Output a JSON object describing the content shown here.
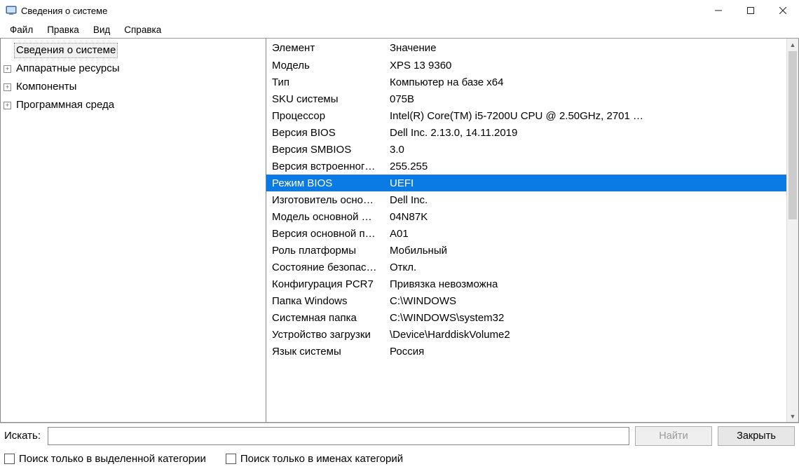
{
  "window": {
    "title": "Сведения о системе"
  },
  "menu": {
    "items": [
      "Файл",
      "Правка",
      "Вид",
      "Справка"
    ]
  },
  "tree": {
    "items": [
      {
        "label": "Сведения о системе",
        "selected": true,
        "expandable": false
      },
      {
        "label": "Аппаратные ресурсы",
        "selected": false,
        "expandable": true
      },
      {
        "label": "Компоненты",
        "selected": false,
        "expandable": true
      },
      {
        "label": "Программная среда",
        "selected": false,
        "expandable": true
      }
    ]
  },
  "list": {
    "columns": [
      "Элемент",
      "Значение"
    ],
    "selected_index": 7,
    "rows": [
      {
        "name": "Модель",
        "value": "XPS 13 9360"
      },
      {
        "name": "Тип",
        "value": "Компьютер на базе x64"
      },
      {
        "name": "SKU системы",
        "value": "075B"
      },
      {
        "name": "Процессор",
        "value": "Intel(R) Core(TM) i5-7200U CPU @ 2.50GHz, 2701 …"
      },
      {
        "name": "Версия BIOS",
        "value": "Dell Inc. 2.13.0, 14.11.2019"
      },
      {
        "name": "Версия SMBIOS",
        "value": "3.0"
      },
      {
        "name": "Версия встроенног…",
        "value": "255.255"
      },
      {
        "name": "Режим BIOS",
        "value": "UEFI"
      },
      {
        "name": "Изготовитель осно…",
        "value": "Dell Inc."
      },
      {
        "name": "Модель основной …",
        "value": "04N87K"
      },
      {
        "name": "Версия основной п…",
        "value": "A01"
      },
      {
        "name": "Роль платформы",
        "value": "Мобильный"
      },
      {
        "name": "Состояние безопас…",
        "value": "Откл."
      },
      {
        "name": "Конфигурация PCR7",
        "value": "Привязка невозможна"
      },
      {
        "name": "Папка Windows",
        "value": "C:\\WINDOWS"
      },
      {
        "name": "Системная папка",
        "value": "C:\\WINDOWS\\system32"
      },
      {
        "name": "Устройство загрузки",
        "value": "\\Device\\HarddiskVolume2"
      },
      {
        "name": "Язык системы",
        "value": "Россия"
      }
    ]
  },
  "search": {
    "label": "Искать:",
    "value": "",
    "find_label": "Найти",
    "close_label": "Закрыть"
  },
  "checks": {
    "only_category": "Поиск только в выделенной категории",
    "only_names": "Поиск только в именах категорий"
  }
}
